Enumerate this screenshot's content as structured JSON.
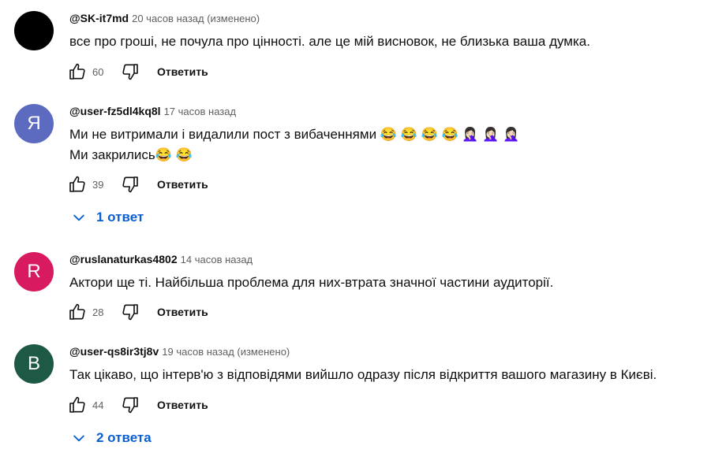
{
  "comments": [
    {
      "author": "@SK-it7md",
      "time": "20 часов назад (изменено)",
      "avatar_letter": "",
      "avatar_color": "#000000",
      "lines": [
        "все про гроші, не почула про цінності. але це мій висновок, не близька ваша думка."
      ],
      "likes": "60",
      "reply_label": "Ответить"
    },
    {
      "author": "@user-fz5dl4kq8l",
      "time": "17 часов назад",
      "avatar_letter": "Я",
      "avatar_color": "#5c6bc0",
      "lines": [
        "Ми не витримали і видалили пост з вибаченнями 😂 😂 😂 😂 🤦🏻‍♀️ 🤦🏻‍♀️ 🤦🏻‍♀️",
        "Ми закрились😂 😂"
      ],
      "likes": "39",
      "reply_label": "Ответить",
      "replies_label": "1 ответ"
    },
    {
      "author": "@ruslanaturkas4802",
      "time": "14 часов назад",
      "avatar_letter": "R",
      "avatar_color": "#d81b60",
      "lines": [
        "Актори ще ті. Найбільша проблема для них-втрата значної частини аудиторії."
      ],
      "likes": "28",
      "reply_label": "Ответить"
    },
    {
      "author": "@user-qs8ir3tj8v",
      "time": "19 часов назад (изменено)",
      "avatar_letter": "B",
      "avatar_color": "#1e5945",
      "lines": [
        "Так цікаво, що інтерв'ю з відповідями вийшло одразу після відкриття вашого магазину в Києві."
      ],
      "likes": "44",
      "reply_label": "Ответить",
      "replies_label": "2 ответа"
    }
  ],
  "colors": {
    "text": "#0f0f0f",
    "secondary": "#606060",
    "link": "#065fd4"
  }
}
